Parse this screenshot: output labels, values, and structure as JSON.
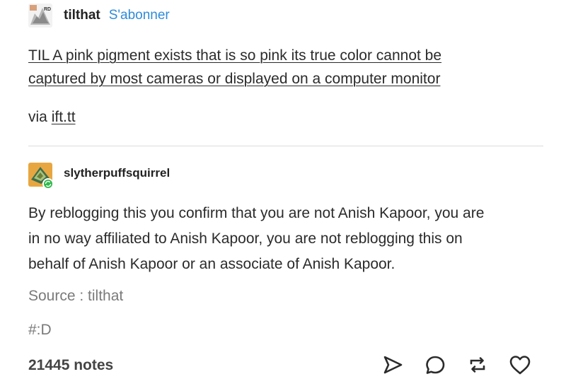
{
  "original_post": {
    "username": "tilthat",
    "follow_label": "S'abonner",
    "title_line1": "TIL A pink pigment exists that is so pink its true color cannot be",
    "title_line2": "captured by most cameras or displayed on a computer monitor",
    "via_label": "via",
    "via_link": "ift.tt"
  },
  "reblog": {
    "username": "slytherpuffsquirrel",
    "body_line1": "By reblogging this you confirm that you are not Anish Kapoor, you are",
    "body_line2": "in no way affiliated to Anish Kapoor, you are not reblogging this on",
    "body_line3": "behalf of Anish Kapoor or an associate of Anish Kapoor.",
    "source": "Source : tilthat",
    "tags": "#:D"
  },
  "footer": {
    "notes": "21445 notes",
    "icons": [
      "send-icon",
      "reply-icon",
      "reblog-icon",
      "like-icon"
    ]
  },
  "colors": {
    "follow_link": "#2f8bd9",
    "avatar2_bg": "#e8a640",
    "online_badge": "#2fb84a"
  }
}
